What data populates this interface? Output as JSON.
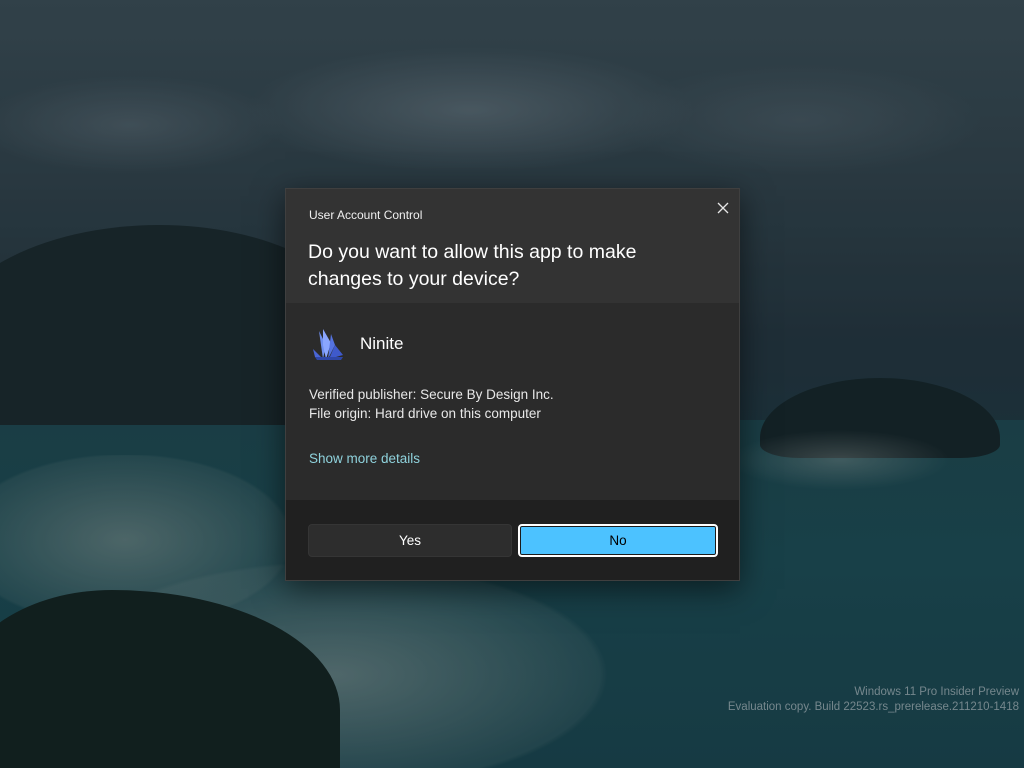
{
  "dialog": {
    "caption": "User Account Control",
    "question": "Do you want to allow this app to make changes to your device?",
    "close_icon": "close-icon",
    "app": {
      "name": "Ninite",
      "icon": "ninite-app-icon"
    },
    "publisher_line": "Verified publisher: Secure By Design Inc.",
    "origin_line": "File origin: Hard drive on this computer",
    "more_details_label": "Show more details",
    "yes_label": "Yes",
    "no_label": "No",
    "colors": {
      "accent": "#4cc2ff",
      "link": "#8fd2dc",
      "header_bg": "#333333",
      "body_bg": "#2b2b2b",
      "footer_bg": "#202020"
    }
  },
  "watermark": {
    "line1": "Windows 11 Pro Insider Preview",
    "line2": "Evaluation copy. Build 22523.rs_prerelease.211210-1418"
  }
}
